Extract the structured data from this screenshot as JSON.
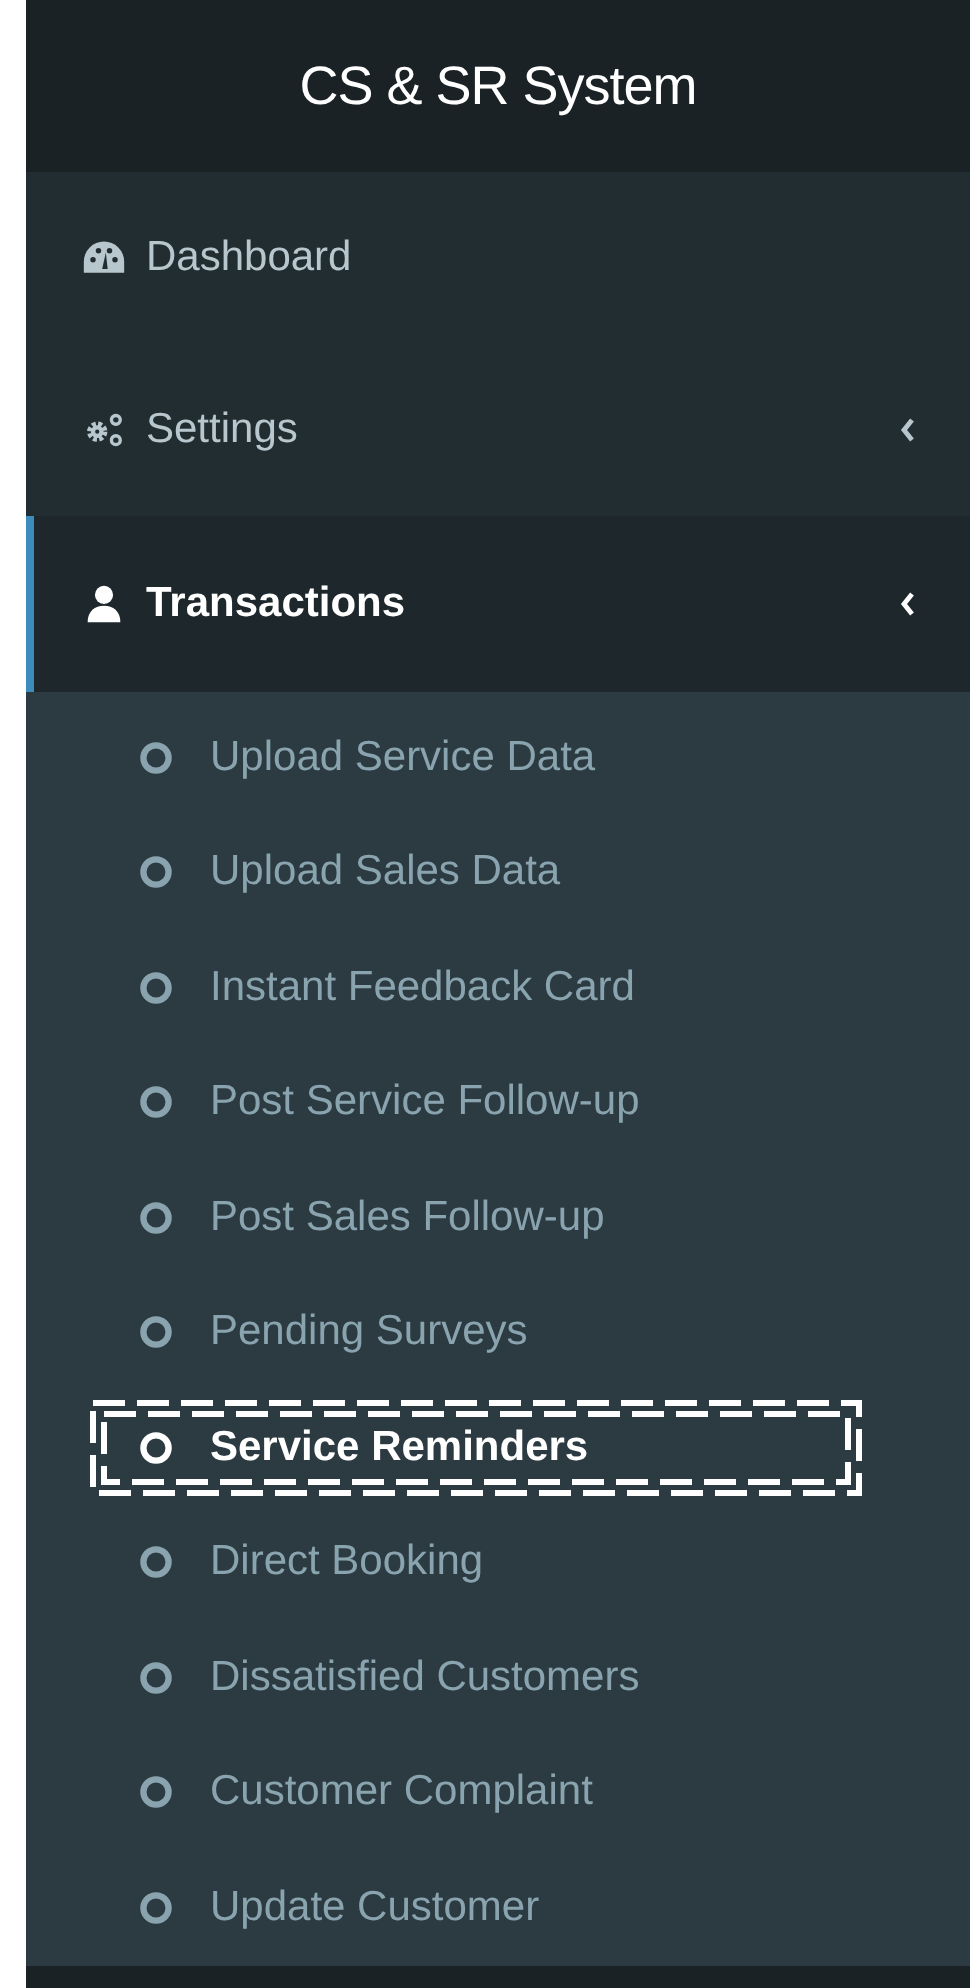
{
  "header": {
    "title": "CS & SR System"
  },
  "menu": [
    {
      "label": "Dashboard",
      "kind": "dashboard",
      "active": false,
      "has_caret": false
    },
    {
      "label": "Settings",
      "kind": "settings",
      "active": false,
      "has_caret": true
    },
    {
      "label": "Transactions",
      "kind": "user",
      "active": true,
      "has_caret": true,
      "expanded": true,
      "children": [
        {
          "label": "Upload Service Data",
          "selected": false
        },
        {
          "label": "Upload Sales Data",
          "selected": false
        },
        {
          "label": "Instant Feedback Card",
          "selected": false
        },
        {
          "label": "Post Service Follow-up",
          "selected": false
        },
        {
          "label": "Post Sales Follow-up",
          "selected": false
        },
        {
          "label": "Pending Surveys",
          "selected": false
        },
        {
          "label": "Service Reminders",
          "selected": true
        },
        {
          "label": "Direct Booking",
          "selected": false
        },
        {
          "label": "Dissatisfied Customers",
          "selected": false
        },
        {
          "label": "Customer Complaint",
          "selected": false
        },
        {
          "label": "Update Customer",
          "selected": false
        }
      ]
    }
  ]
}
